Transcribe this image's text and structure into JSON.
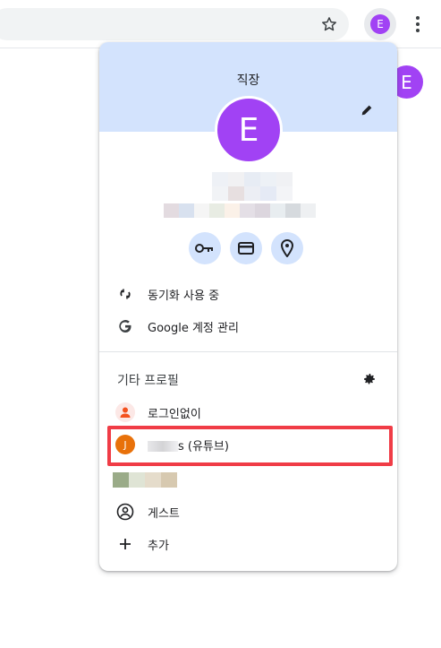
{
  "toolbar": {
    "star_icon": "star-outline-icon",
    "profile_initial": "E",
    "menu_icon": "vertical-dots-icon"
  },
  "page": {
    "avatar_initial": "E"
  },
  "popup": {
    "profile_name": "직장",
    "avatar_initial": "E",
    "sync_label": "동기화 사용 중",
    "manage_account_label": "Google 계정 관리",
    "other_profiles_title": "기타 프로필",
    "profiles": [
      {
        "name": "로그인없이",
        "initial": "",
        "color": "#f4511e"
      },
      {
        "name_suffix": "s (유튜브)",
        "initial": "J",
        "color": "#e8710a"
      }
    ],
    "guest_label": "게스트",
    "add_label": "추가"
  },
  "colors": {
    "accent": "#a142f4",
    "header_bg": "#d3e3fd",
    "highlight": "#f03c46"
  }
}
